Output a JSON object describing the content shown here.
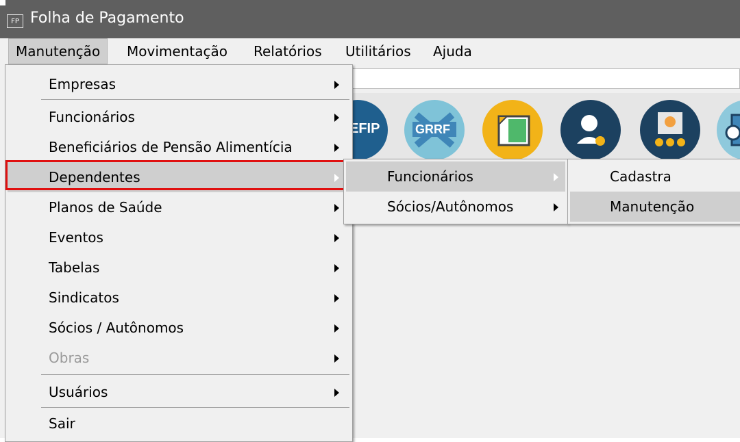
{
  "window": {
    "title": "Folha de Pagamento",
    "icon_text": "FP"
  },
  "menubar": [
    "Manutenção",
    "Movimentação",
    "Relatórios",
    "Utilitários",
    "Ajuda"
  ],
  "toolbar_icons": [
    {
      "name": "sefip-icon",
      "text": "EFIP",
      "color": "#1f5f8e"
    },
    {
      "name": "grrf-icon",
      "text": "GRRF",
      "color": "#7fc3d8"
    },
    {
      "name": "document-icon",
      "text": "",
      "color": "#f2b318"
    },
    {
      "name": "support-agent-icon",
      "text": "",
      "color": "#1c4160"
    },
    {
      "name": "meeting-icon",
      "text": "",
      "color": "#1c4160"
    },
    {
      "name": "export-icon",
      "text": "",
      "color": "#8ec9dc"
    }
  ],
  "menu_main": {
    "items": [
      {
        "label": "Empresas",
        "has_submenu": true
      },
      {
        "label": "Funcionários",
        "has_submenu": true
      },
      {
        "label": "Beneficiários de Pensão Alimentícia",
        "has_submenu": true
      },
      {
        "label": "Dependentes",
        "has_submenu": true,
        "highlighted": true
      },
      {
        "label": "Planos de Saúde",
        "has_submenu": true
      },
      {
        "label": "Eventos",
        "has_submenu": true
      },
      {
        "label": "Tabelas",
        "has_submenu": true
      },
      {
        "label": "Sindicatos",
        "has_submenu": true
      },
      {
        "label": "Sócios / Autônomos",
        "has_submenu": true
      },
      {
        "label": "Obras",
        "has_submenu": true,
        "disabled": true
      },
      {
        "label": "Usuários",
        "has_submenu": true
      },
      {
        "label": "Sair",
        "has_submenu": false
      }
    ]
  },
  "menu_dependentes": {
    "items": [
      {
        "label": "Funcionários",
        "highlighted": true
      },
      {
        "label": "Sócios/Autônomos"
      }
    ]
  },
  "menu_funcionarios": {
    "items": [
      {
        "label": "Cadastra"
      },
      {
        "label": "Manutenção",
        "highlighted": true
      }
    ]
  },
  "colors": {
    "highlight": "#cfcfcf",
    "annotation": "#e01010"
  }
}
